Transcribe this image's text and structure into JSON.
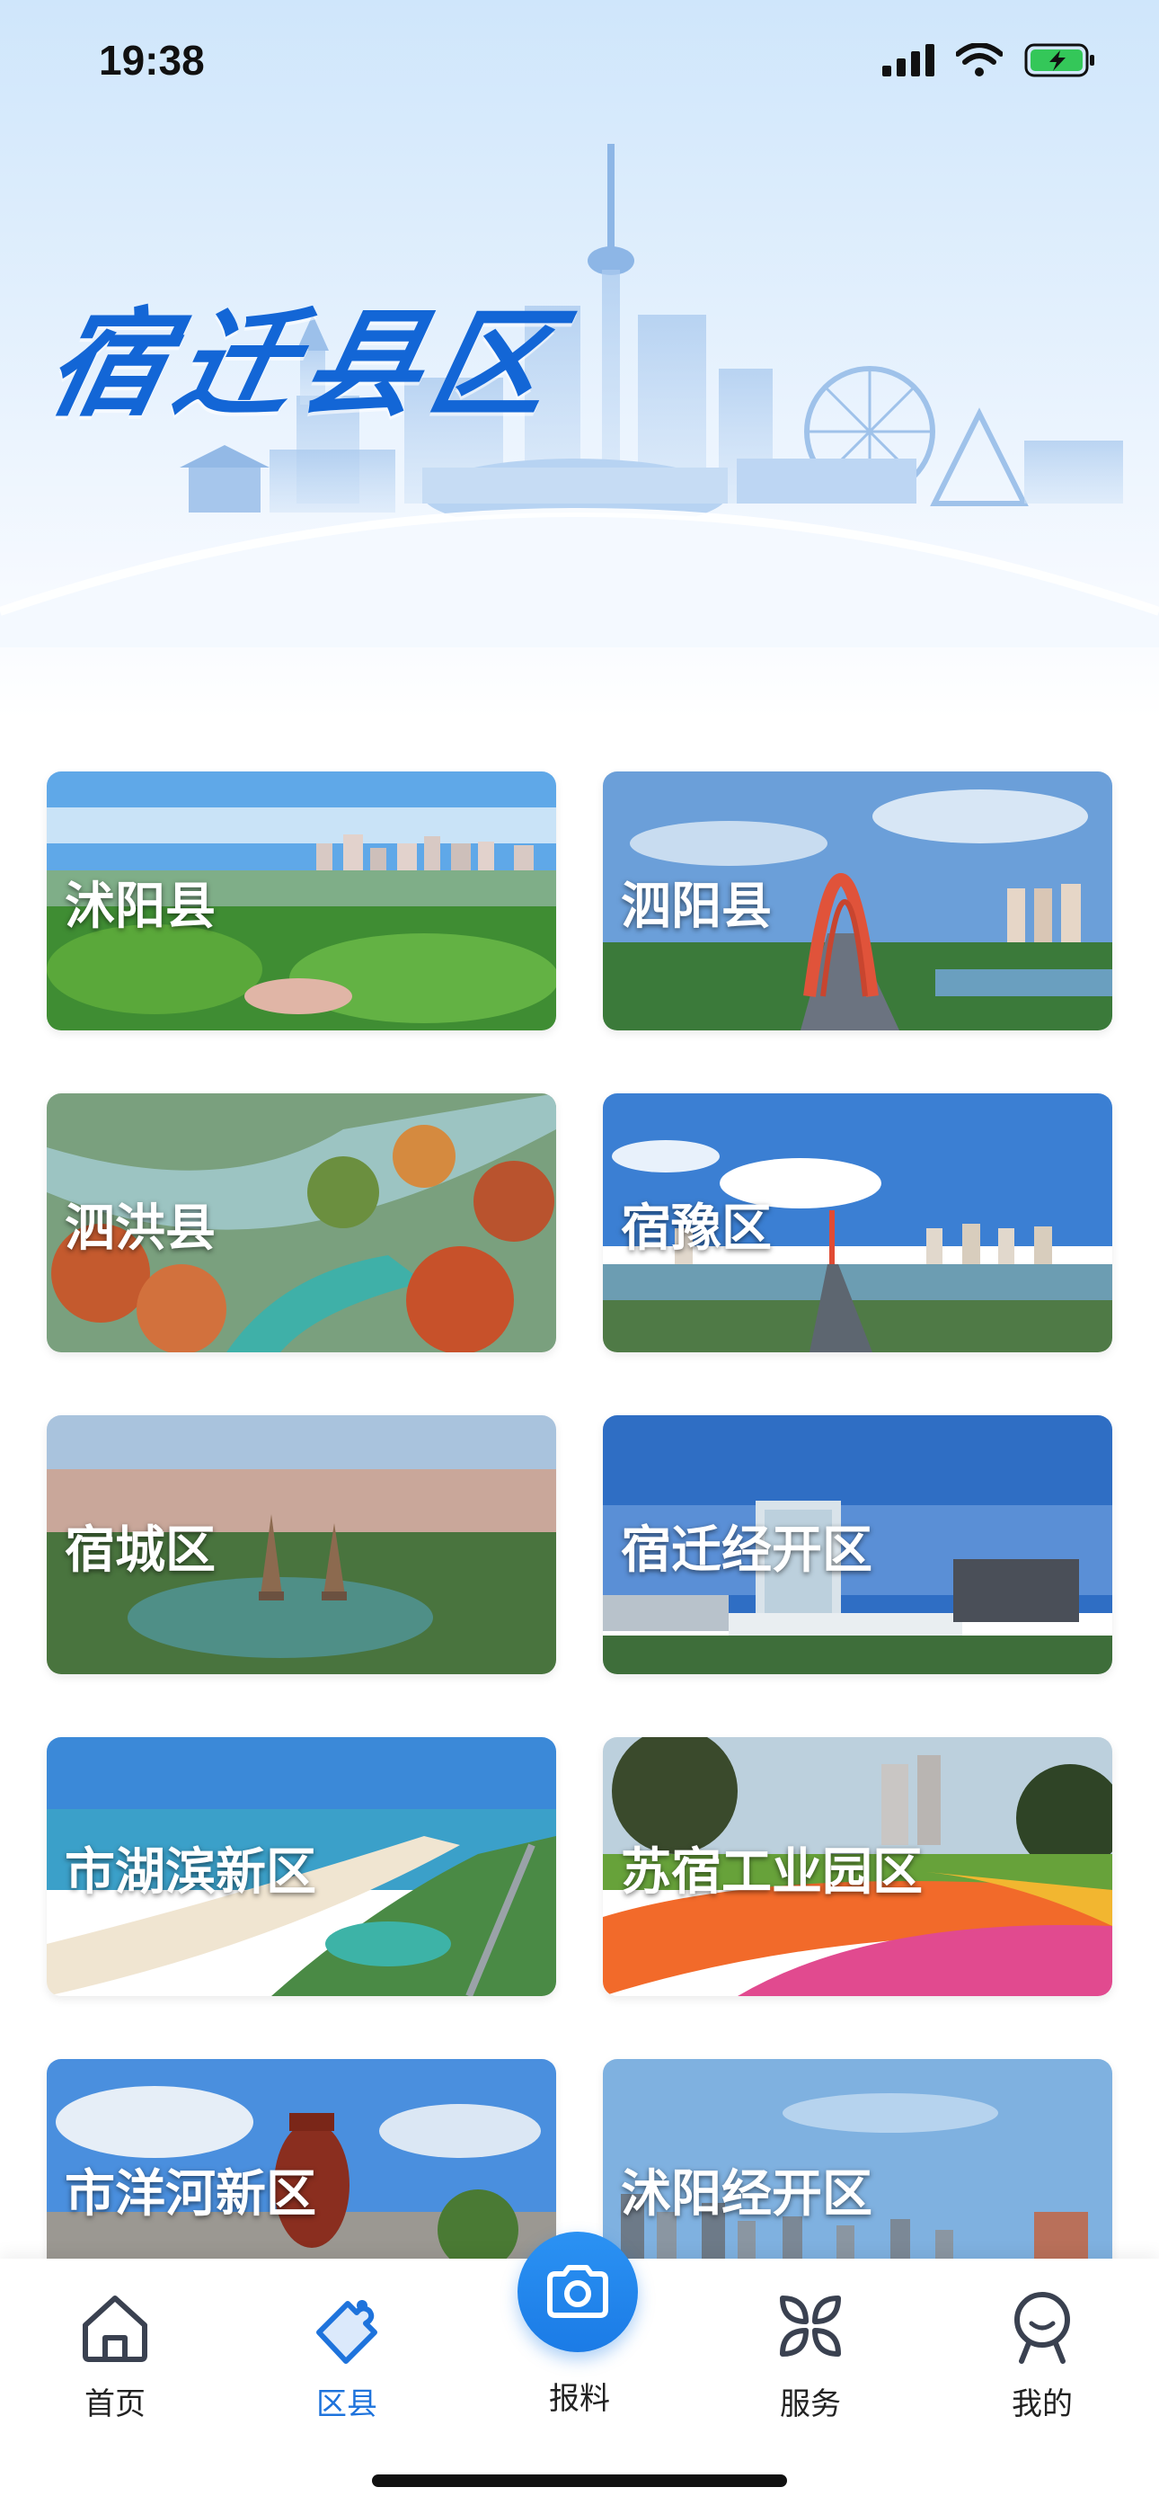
{
  "status_bar": {
    "time": "19:38",
    "battery_color": "#34c759"
  },
  "hero": {
    "title": "宿迁县区",
    "accent_color": "#1366d6"
  },
  "districts": [
    {
      "label": "沭阳县",
      "theme": "park-city"
    },
    {
      "label": "泗阳县",
      "theme": "red-arch-bridge"
    },
    {
      "label": "泗洪县",
      "theme": "autumn-wetland"
    },
    {
      "label": "宿豫区",
      "theme": "river-bridge-city"
    },
    {
      "label": "宿城区",
      "theme": "twin-pagoda-lake"
    },
    {
      "label": "宿迁经开区",
      "theme": "modern-building"
    },
    {
      "label": "市湖滨新区",
      "theme": "lake-beach"
    },
    {
      "label": "苏宿工业园区",
      "theme": "flower-garden"
    },
    {
      "label": "市洋河新区",
      "theme": "wine-jar-landmark"
    },
    {
      "label": "沭阳经开区",
      "theme": "city-skyline"
    }
  ],
  "tab_bar": {
    "active_color": "#1e73dc",
    "tabs": [
      {
        "label": "首页",
        "icon": "home-icon"
      },
      {
        "label": "区县",
        "icon": "district-icon"
      },
      {
        "label": "报料",
        "icon": "camera-icon"
      },
      {
        "label": "服务",
        "icon": "services-icon"
      },
      {
        "label": "我的",
        "icon": "profile-icon"
      }
    ]
  }
}
